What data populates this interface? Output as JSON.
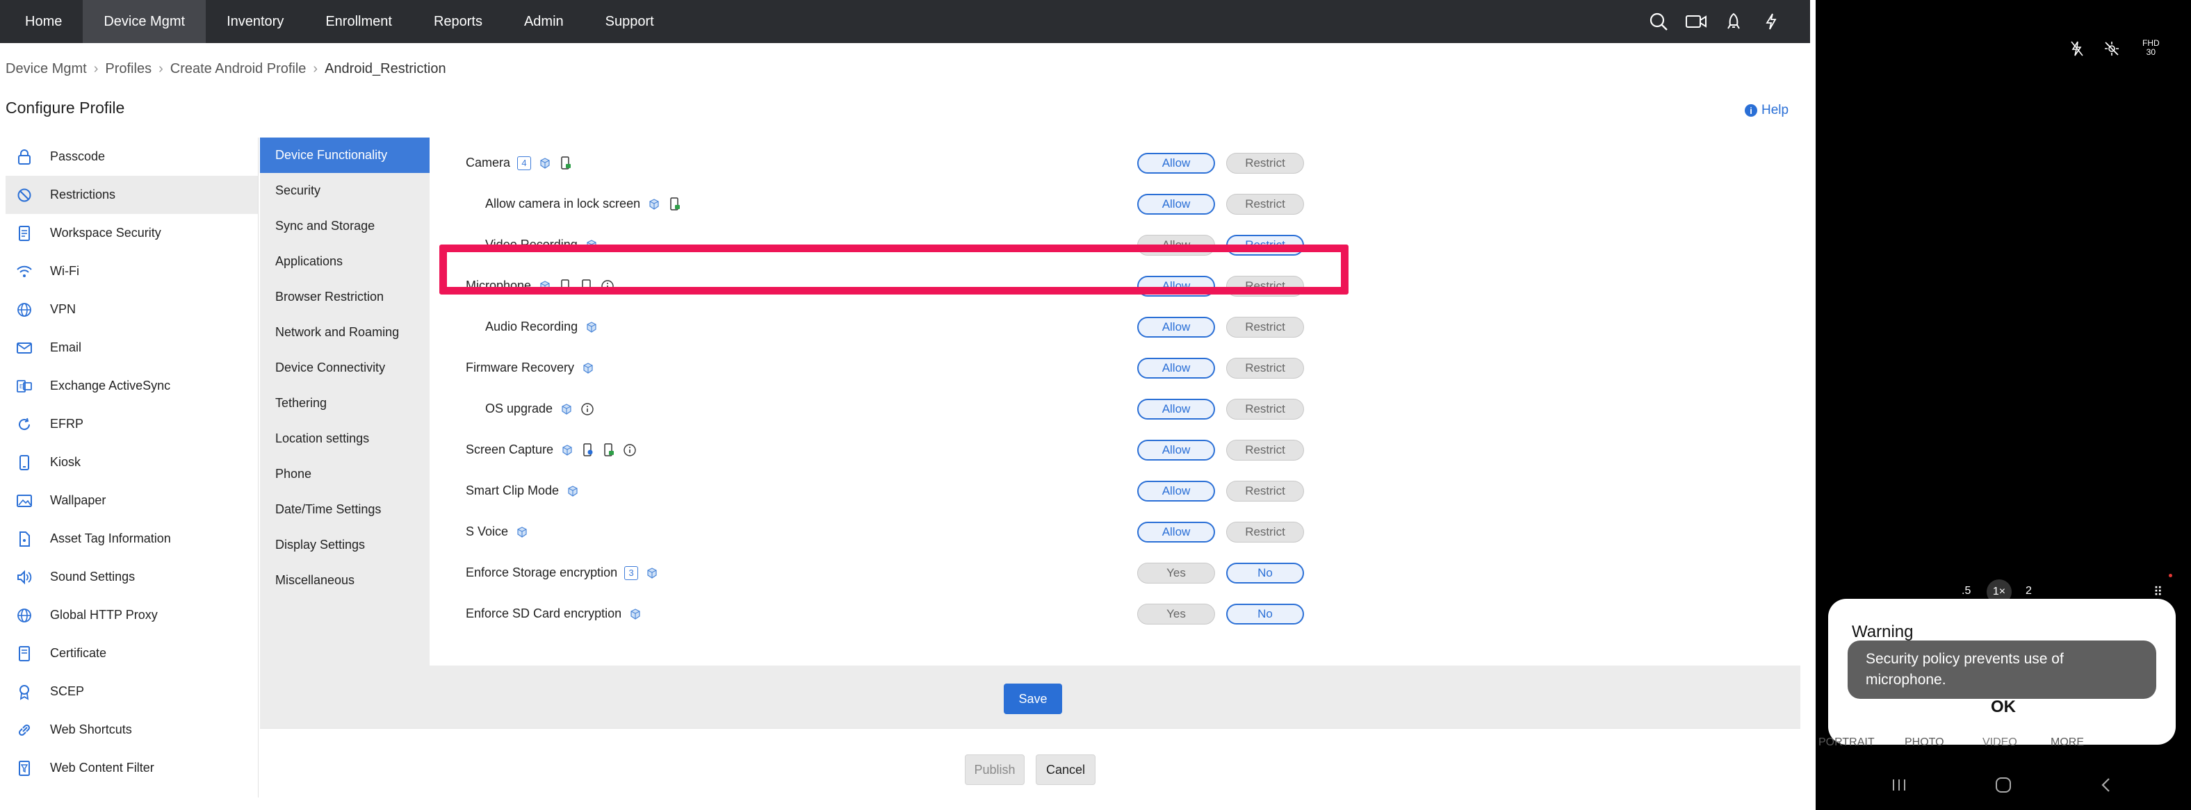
{
  "nav": {
    "items": [
      "Home",
      "Device Mgmt",
      "Inventory",
      "Enrollment",
      "Reports",
      "Admin",
      "Support"
    ],
    "active": "Device Mgmt",
    "icons": [
      "search-icon",
      "video-icon",
      "rocket-icon",
      "bolt-icon"
    ]
  },
  "breadcrumb": [
    "Device Mgmt",
    "Profiles",
    "Create Android Profile",
    "Android_Restriction"
  ],
  "page": {
    "title": "Configure Profile",
    "help": "Help"
  },
  "sidebar": {
    "items": [
      {
        "label": "Passcode",
        "icon": "lock-icon"
      },
      {
        "label": "Restrictions",
        "icon": "block-icon"
      },
      {
        "label": "Workspace Security",
        "icon": "document-icon"
      },
      {
        "label": "Wi-Fi",
        "icon": "wifi-icon"
      },
      {
        "label": "VPN",
        "icon": "globe-icon"
      },
      {
        "label": "Email",
        "icon": "mail-icon"
      },
      {
        "label": "Exchange ActiveSync",
        "icon": "exchange-icon"
      },
      {
        "label": "EFRP",
        "icon": "refresh-icon"
      },
      {
        "label": "Kiosk",
        "icon": "phone-icon"
      },
      {
        "label": "Wallpaper",
        "icon": "image-icon"
      },
      {
        "label": "Asset Tag Information",
        "icon": "tag-icon"
      },
      {
        "label": "Sound Settings",
        "icon": "speaker-icon"
      },
      {
        "label": "Global HTTP Proxy",
        "icon": "globe-icon"
      },
      {
        "label": "Certificate",
        "icon": "certificate-icon"
      },
      {
        "label": "SCEP",
        "icon": "badge-icon"
      },
      {
        "label": "Web Shortcuts",
        "icon": "link-icon"
      },
      {
        "label": "Web Content Filter",
        "icon": "filter-icon"
      }
    ],
    "active": "Restrictions"
  },
  "submenu": {
    "items": [
      "Device Functionality",
      "Security",
      "Sync and Storage",
      "Applications",
      "Browser Restriction",
      "Network and Roaming",
      "Device Connectivity",
      "Tethering",
      "Location settings",
      "Phone",
      "Date/Time Settings",
      "Display Settings",
      "Miscellaneous"
    ],
    "active": "Device Functionality"
  },
  "restrictions": [
    {
      "label": "Camera",
      "badge": "4",
      "icons": [
        "cube-icon",
        "device-lock-icon"
      ],
      "options": [
        "Allow",
        "Restrict"
      ],
      "selected": "Allow",
      "indent": false
    },
    {
      "label": "Allow camera in lock screen",
      "badge": "",
      "icons": [
        "cube-icon",
        "device-lock-icon"
      ],
      "options": [
        "Allow",
        "Restrict"
      ],
      "selected": "Allow",
      "indent": true
    },
    {
      "label": "Video Recording",
      "badge": "",
      "icons": [
        "cube-icon"
      ],
      "options": [
        "Allow",
        "Restrict"
      ],
      "selected": "Restrict",
      "indent": true
    },
    {
      "label": "Microphone",
      "badge": "",
      "icons": [
        "cube-icon",
        "device-lock-icon",
        "device-icon",
        "info-icon"
      ],
      "options": [
        "Allow",
        "Restrict"
      ],
      "selected": "Allow",
      "indent": false
    },
    {
      "label": "Audio Recording",
      "badge": "",
      "icons": [
        "cube-icon"
      ],
      "options": [
        "Allow",
        "Restrict"
      ],
      "selected": "Allow",
      "indent": true
    },
    {
      "label": "Firmware Recovery",
      "badge": "",
      "icons": [
        "cube-icon"
      ],
      "options": [
        "Allow",
        "Restrict"
      ],
      "selected": "Allow",
      "indent": false
    },
    {
      "label": "OS upgrade",
      "badge": "",
      "icons": [
        "cube-icon",
        "info-icon"
      ],
      "options": [
        "Allow",
        "Restrict"
      ],
      "selected": "Allow",
      "indent": true
    },
    {
      "label": "Screen Capture",
      "badge": "",
      "icons": [
        "cube-icon",
        "device-user-icon",
        "device-lock-icon",
        "info-icon"
      ],
      "options": [
        "Allow",
        "Restrict"
      ],
      "selected": "Allow",
      "indent": false
    },
    {
      "label": "Smart Clip Mode",
      "badge": "",
      "icons": [
        "cube-icon"
      ],
      "options": [
        "Allow",
        "Restrict"
      ],
      "selected": "Allow",
      "indent": false
    },
    {
      "label": "S Voice",
      "badge": "",
      "icons": [
        "cube-icon"
      ],
      "options": [
        "Allow",
        "Restrict"
      ],
      "selected": "Allow",
      "indent": false
    },
    {
      "label": "Enforce Storage encryption",
      "badge": "3",
      "icons": [
        "cube-icon"
      ],
      "options": [
        "Yes",
        "No"
      ],
      "selected": "No",
      "indent": false
    },
    {
      "label": "Enforce SD Card encryption",
      "badge": "",
      "icons": [
        "cube-icon"
      ],
      "options": [
        "Yes",
        "No"
      ],
      "selected": "No",
      "indent": false
    }
  ],
  "actions": {
    "save": "Save",
    "publish": "Publish",
    "cancel": "Cancel"
  },
  "phone": {
    "status_icons": [
      "flash-off-icon",
      "motion-off-icon"
    ],
    "resolution": "FHD",
    "fps": "30",
    "zoom": [
      ".5",
      "1×",
      "2"
    ],
    "dialog_title": "Warning",
    "toast": "Security policy prevents use of microphone.",
    "ok": "OK",
    "modes": [
      "PORTRAIT",
      "PHOTO",
      "VIDEO",
      "MORE"
    ],
    "nav_icons": [
      "recents-icon",
      "home-icon",
      "back-icon"
    ]
  },
  "colors": {
    "accent": "#2a6fd6",
    "highlight": "#ee1556",
    "topbar": "#2b2d31"
  }
}
